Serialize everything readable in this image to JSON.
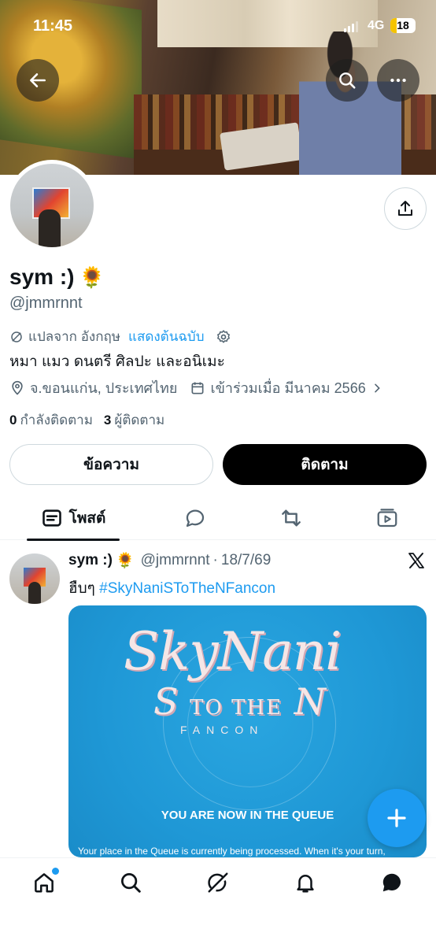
{
  "status_bar": {
    "time": "11:45",
    "network": "4G",
    "battery": "18"
  },
  "profile": {
    "name": "sym :)",
    "name_emoji": "🌻",
    "handle": "@jmmrnnt",
    "translation_note": "แปลจาก อังกฤษ",
    "show_original": "แสดงต้นฉบับ",
    "bio": "หมา แมว ดนตรี ศิลปะ และอนิเมะ",
    "location": "จ.ขอนแก่น, ประเทศไทย",
    "joined": "เข้าร่วมเมื่อ มีนาคม 2566",
    "following_count": "0",
    "following_label": "กำลังติดตาม",
    "followers_count": "3",
    "followers_label": "ผู้ติดตาม"
  },
  "actions": {
    "message": "ข้อความ",
    "follow": "ติดตาม"
  },
  "tabs": {
    "posts": "โพสต์"
  },
  "post": {
    "name": "sym :)",
    "emoji": "🌻",
    "handle": "@jmmrnnt",
    "date": "18/7/69",
    "text_prefix": "ฮืบๆ ",
    "hashtag": "#SkyNaniSToTheNFancon",
    "media": {
      "logo_line1": "SkyNani",
      "logo_line2_a": "S",
      "logo_line2_b": "TO THE",
      "logo_line2_c": "N",
      "logo_line3": "FANCON",
      "queue_title": "YOU ARE NOW IN THE QUEUE",
      "queue_text": "Your place in the Queue is currently being processed. When it's your turn,"
    }
  },
  "icons": {
    "back": "arrow-left-icon",
    "search": "search-icon",
    "more": "more-icon",
    "share": "share-icon",
    "compose": "plus-icon",
    "home": "home-icon",
    "explore": "search-icon",
    "grok": "grok-icon",
    "notifications": "bell-icon",
    "messages": "chat-icon"
  },
  "colors": {
    "accent": "#1d9bf0",
    "text": "#0f1419",
    "muted": "#536471"
  }
}
